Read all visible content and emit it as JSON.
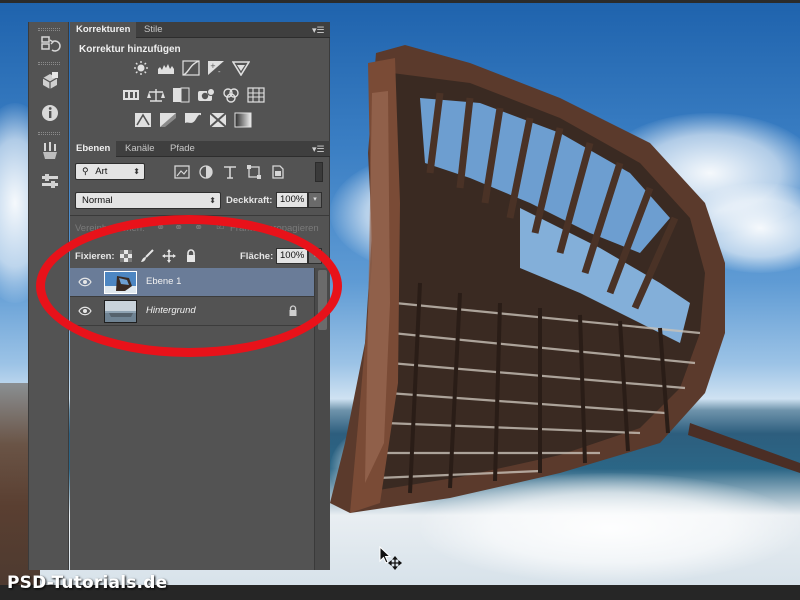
{
  "canvas": {
    "cursor_icon": "move-cursor-icon"
  },
  "tool_column": {
    "icons": [
      "history-icon",
      "3d-material-icon",
      "info-icon",
      "brushes-icon",
      "tool-presets-icon"
    ]
  },
  "corrections_panel": {
    "tabs": [
      {
        "label": "Korrekturen",
        "active": true
      },
      {
        "label": "Stile",
        "active": false
      }
    ],
    "heading": "Korrektur hinzufügen",
    "icons_row1": [
      "brightness-contrast-icon",
      "levels-icon",
      "curves-icon",
      "exposure-icon",
      "vibrance-icon"
    ],
    "icons_row2": [
      "hue-saturation-icon",
      "color-balance-icon",
      "black-white-icon",
      "photo-filter-icon",
      "channel-mixer-icon",
      "color-lookup-icon"
    ],
    "icons_row3": [
      "invert-icon",
      "posterize-icon",
      "threshold-icon",
      "selective-color-icon",
      "gradient-map-icon"
    ]
  },
  "layers_panel": {
    "tabs": [
      {
        "label": "Ebenen",
        "active": true
      },
      {
        "label": "Kanäle",
        "active": false
      },
      {
        "label": "Pfade",
        "active": false
      }
    ],
    "filter": {
      "label": "Art",
      "search_icon": "search-icon"
    },
    "filter_icons": [
      "pixel-filter-icon",
      "adjustment-filter-icon",
      "type-filter-icon",
      "shape-filter-icon",
      "smart-object-filter-icon"
    ],
    "blend_mode": "Normal",
    "opacity_label": "Deckkraft:",
    "opacity_value": "100%",
    "unify_label": "Vereinheitlichen:",
    "propagate_label": "Frame 1 propagieren",
    "lock_label": "Fixieren:",
    "lock_icons": [
      "lock-transparent-icon",
      "lock-image-icon",
      "lock-position-icon",
      "lock-all-icon"
    ],
    "fill_label": "Fläche:",
    "fill_value": "100%",
    "layers": [
      {
        "name": "Ebene 1",
        "selected": true,
        "visible": true,
        "locked": false,
        "italic": false
      },
      {
        "name": "Hintergrund",
        "selected": false,
        "visible": true,
        "locked": true,
        "italic": true
      }
    ]
  },
  "watermark": "PSD-Tutorials.de",
  "colors": {
    "panel_bg": "#535353",
    "selected_layer": "#6a7c98",
    "annotation_red": "#e8121a"
  }
}
